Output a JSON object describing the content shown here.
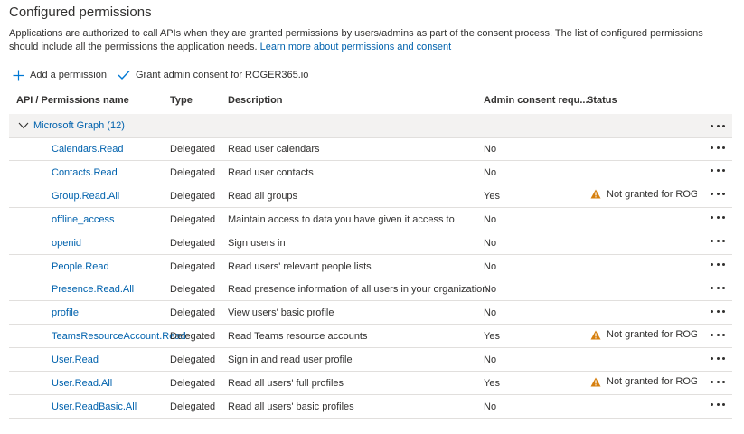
{
  "page": {
    "title": "Configured permissions",
    "description": "Applications are authorized to call APIs when they are granted permissions by users/admins as part of the consent process. The list of configured permissions should include all the permissions the application needs.",
    "learn_more_link": "Learn more about permissions and consent"
  },
  "toolbar": {
    "add_permission_label": "Add a permission",
    "grant_consent_label": "Grant admin consent for ROGER365.io"
  },
  "table": {
    "columns": {
      "api": "API / Permissions name",
      "type": "Type",
      "description": "Description",
      "admin_consent": "Admin consent requ...",
      "status": "Status"
    },
    "group": {
      "label": "Microsoft Graph (12)"
    },
    "rows": [
      {
        "name": "Calendars.Read",
        "type": "Delegated",
        "description": "Read user calendars",
        "admin": "No",
        "status": ""
      },
      {
        "name": "Contacts.Read",
        "type": "Delegated",
        "description": "Read user contacts",
        "admin": "No",
        "status": ""
      },
      {
        "name": "Group.Read.All",
        "type": "Delegated",
        "description": "Read all groups",
        "admin": "Yes",
        "status": "Not granted for ROGER..."
      },
      {
        "name": "offline_access",
        "type": "Delegated",
        "description": "Maintain access to data you have given it access to",
        "admin": "No",
        "status": ""
      },
      {
        "name": "openid",
        "type": "Delegated",
        "description": "Sign users in",
        "admin": "No",
        "status": ""
      },
      {
        "name": "People.Read",
        "type": "Delegated",
        "description": "Read users' relevant people lists",
        "admin": "No",
        "status": ""
      },
      {
        "name": "Presence.Read.All",
        "type": "Delegated",
        "description": "Read presence information of all users in your organization",
        "admin": "No",
        "status": ""
      },
      {
        "name": "profile",
        "type": "Delegated",
        "description": "View users' basic profile",
        "admin": "No",
        "status": ""
      },
      {
        "name": "TeamsResourceAccount.Read",
        "type": "Delegated",
        "description": "Read Teams resource accounts",
        "admin": "Yes",
        "status": "Not granted for ROGER..."
      },
      {
        "name": "User.Read",
        "type": "Delegated",
        "description": "Sign in and read user profile",
        "admin": "No",
        "status": ""
      },
      {
        "name": "User.Read.All",
        "type": "Delegated",
        "description": "Read all users' full profiles",
        "admin": "Yes",
        "status": "Not granted for ROGER..."
      },
      {
        "name": "User.ReadBasic.All",
        "type": "Delegated",
        "description": "Read all users' basic profiles",
        "admin": "No",
        "status": ""
      }
    ]
  },
  "icons": {
    "add": "plus-icon",
    "grant": "checkmark-icon",
    "group_toggle": "chevron-down-icon",
    "warning": "warning-icon",
    "more": "more-icon"
  },
  "colors": {
    "link": "#0062ad",
    "warning": "#d67f0e",
    "group_bg": "#f3f2f1",
    "border": "#e1dfdd"
  }
}
